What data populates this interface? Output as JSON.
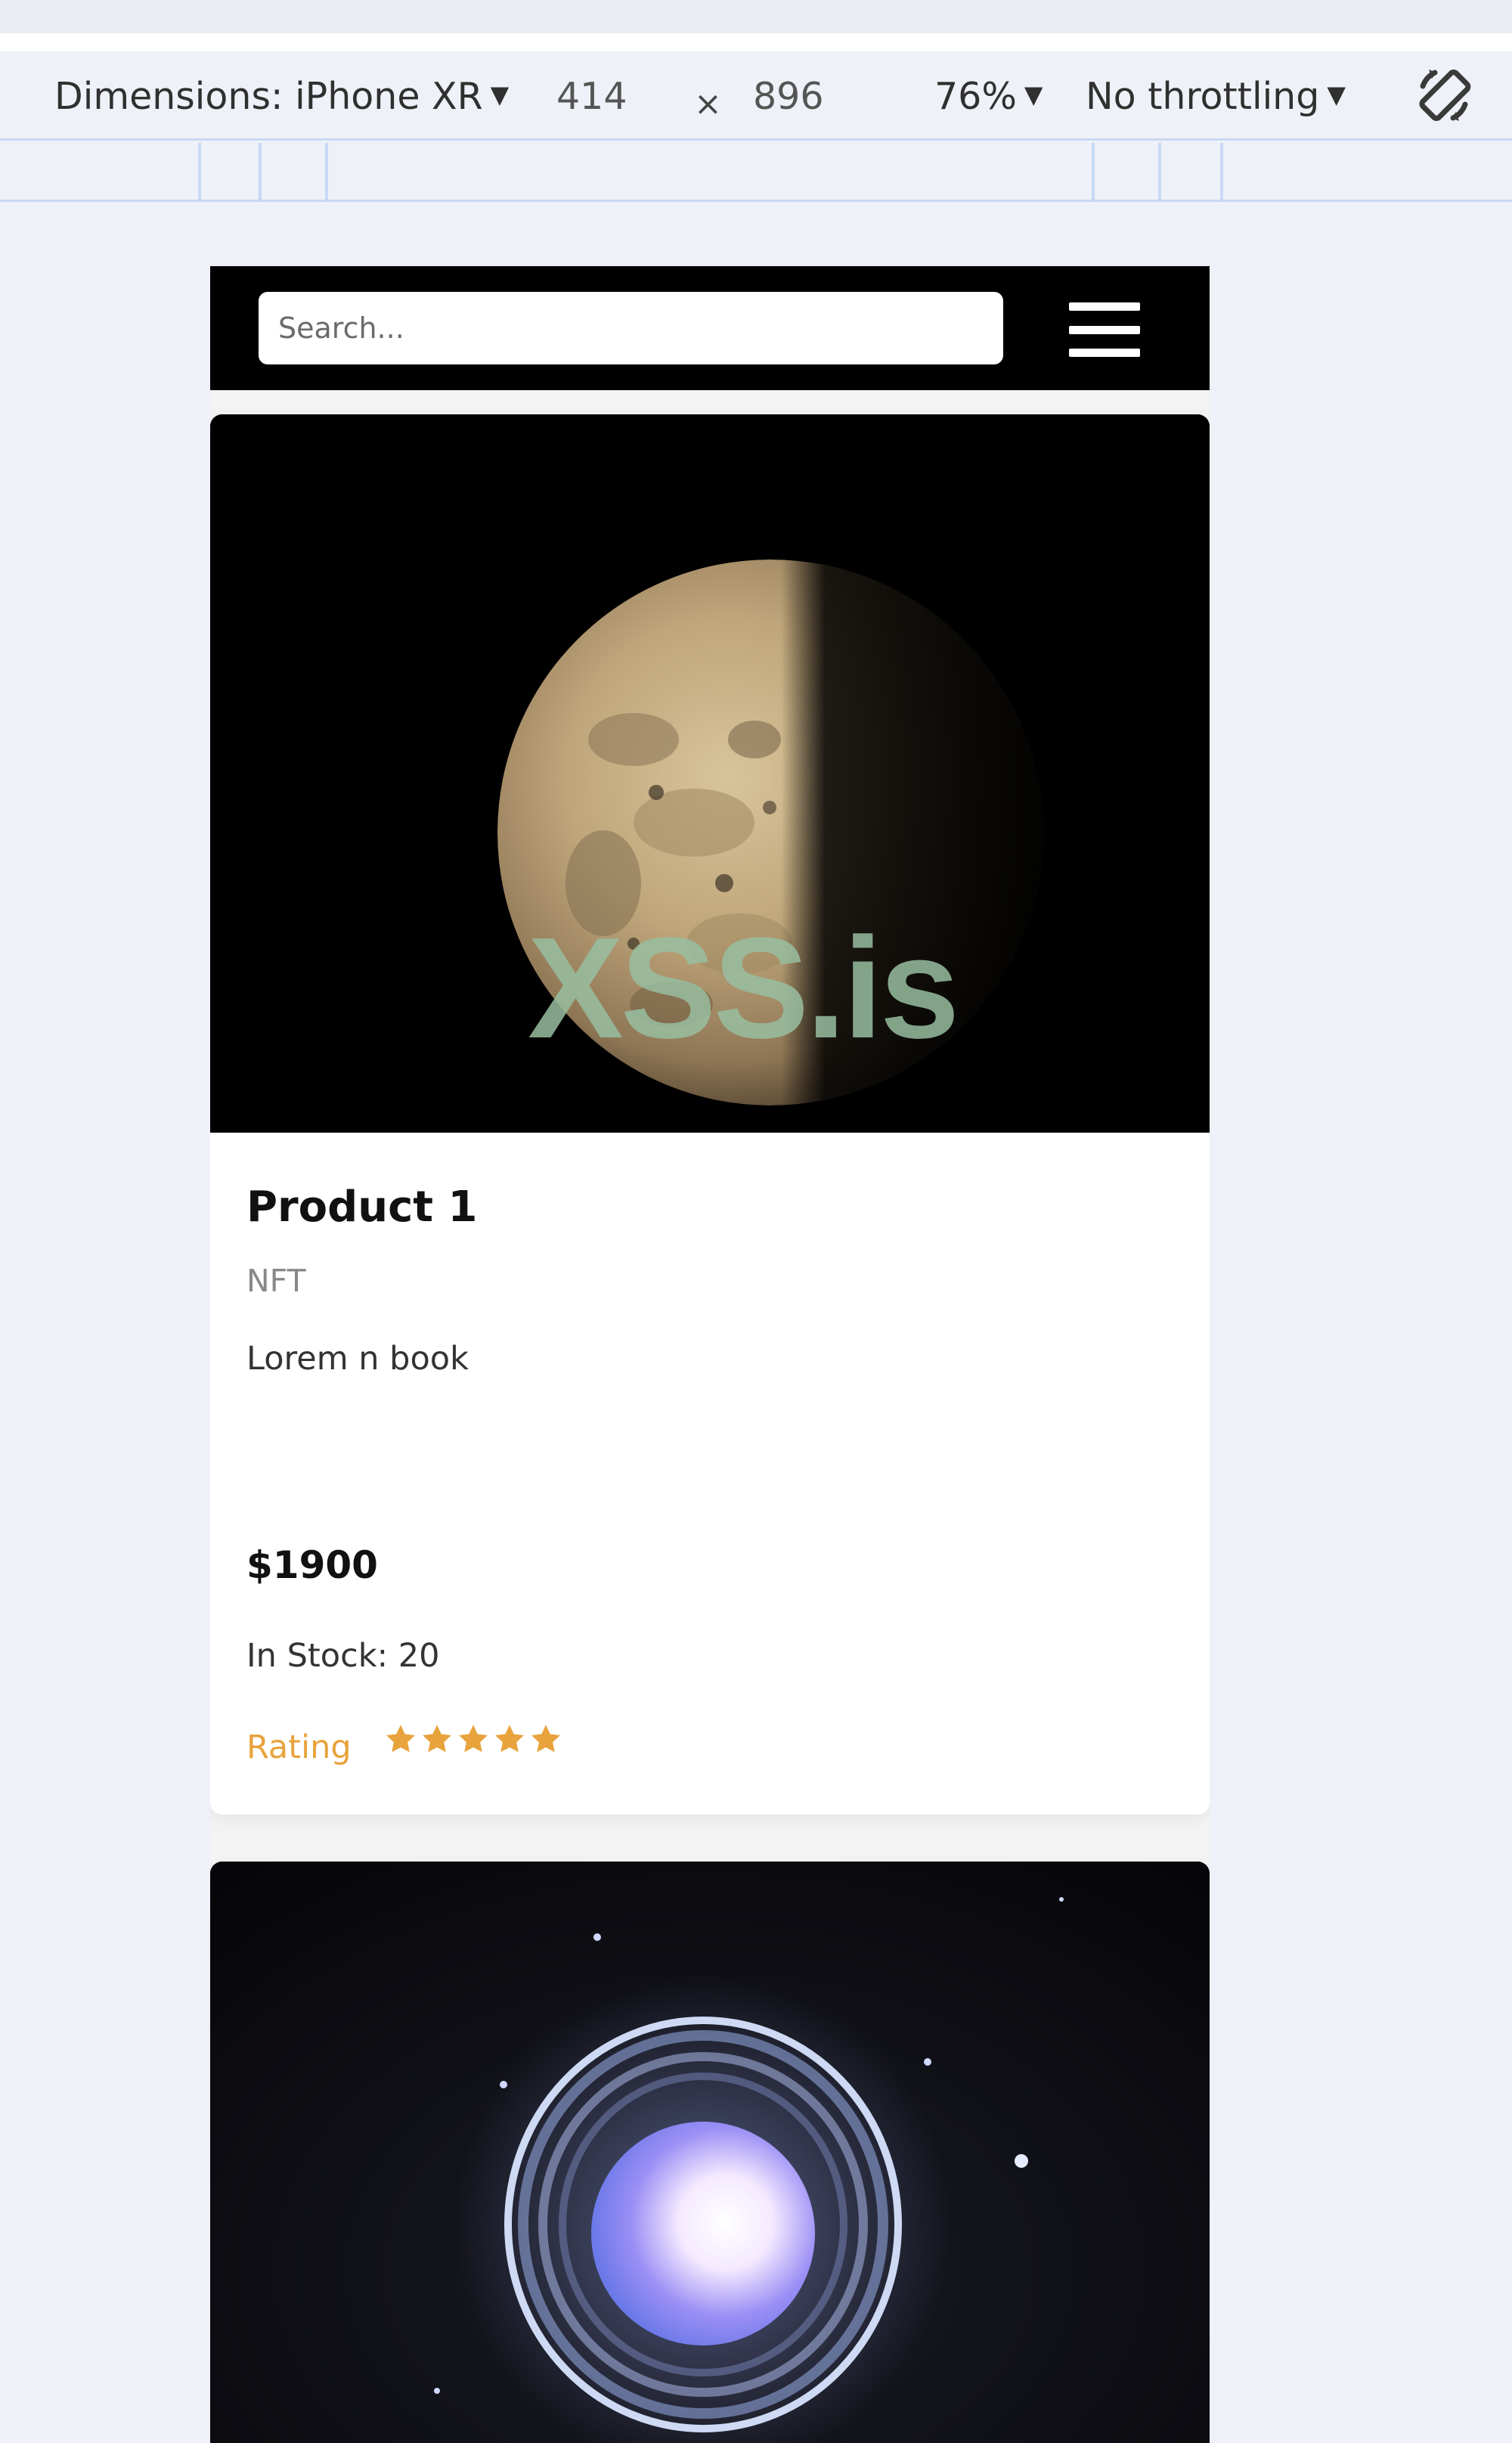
{
  "devtools": {
    "dimensions_label": "Dimensions: iPhone XR",
    "width": "414",
    "times": "×",
    "height": "896",
    "zoom": "76%",
    "throttling": "No throttling",
    "caret_icon": "▼",
    "rotate_icon": "rotate-icon"
  },
  "navbar": {
    "search_placeholder": "Search...",
    "menu_icon": "hamburger-icon"
  },
  "products": [
    {
      "image": "planet-io-half-lit",
      "watermark": "XSS.is",
      "title": "Product 1",
      "category": "NFT",
      "description": "Lorem n book",
      "price": "$1900",
      "stock": "In Stock: 20",
      "rating_label": "Rating",
      "rating": 5,
      "rating_max": 5
    },
    {
      "image": "planet-uranus-rings"
    }
  ],
  "colors": {
    "page_background": "#eef1f7",
    "navbar": "#000000",
    "rating_accent": "#e8a33d",
    "devtools_border": "#c8d8f5"
  }
}
